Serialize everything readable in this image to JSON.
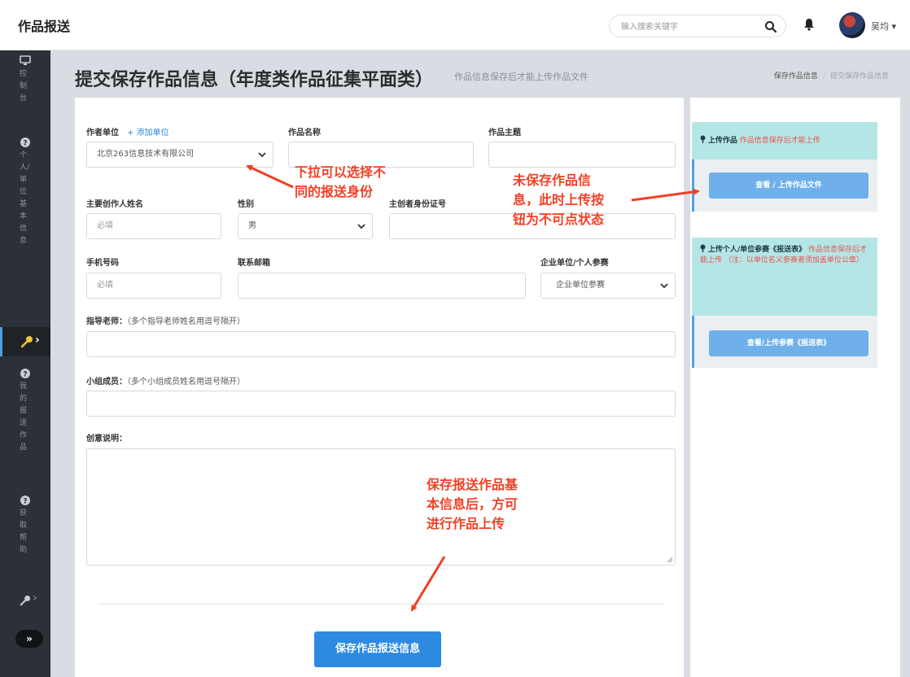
{
  "topbar": {
    "brand": "作品报送",
    "search_placeholder": "输入搜索关键字",
    "username": "吴均 ▾"
  },
  "sidebar": {
    "groups": [
      {
        "icon": "monitor-icon",
        "label": "控制台"
      },
      {
        "icon": "help-circle-icon",
        "label": "个人/单位基本信息"
      },
      {
        "icon": "help-circle-icon",
        "label": "我的报送作品"
      },
      {
        "icon": "help-circle-icon",
        "label": "获取帮助"
      }
    ],
    "active_arrow": "›",
    "key_arrow": "›",
    "collapse_label": "»"
  },
  "header": {
    "title": "提交保存作品信息（年度类作品征集平面类）",
    "subtitle": "作品信息保存后才能上传作品文件",
    "breadcrumb": [
      "保存作品信息",
      "提交保存作品信息"
    ]
  },
  "form": {
    "author_unit_label": "作者单位",
    "add_unit_link": "+ 添加单位",
    "author_unit_value": "北京263信息技术有限公司",
    "work_name_label": "作品名称",
    "work_theme_label": "作品主题",
    "creator_name_label": "主要创作人姓名",
    "creator_name_placeholder": "必填",
    "gender_label": "性别",
    "gender_value": "男",
    "id_label": "主创者身份证号",
    "phone_label": "手机号码",
    "phone_placeholder": "必填",
    "email_label": "联系邮箱",
    "entry_type_label": "企业单位/个人参赛",
    "entry_type_value": "企业单位参赛",
    "teacher_label": "指导老师：",
    "teacher_hint": "（多个指导老师姓名用逗号隔开）",
    "members_label": "小组成员：",
    "members_hint": "（多个小组成员姓名用逗号隔开）",
    "creative_label": "创意说明：",
    "save_button": "保存作品报送信息"
  },
  "right": {
    "upload_work_title": "上传作品",
    "upload_work_note": "作品信息保存后才能上传",
    "upload_work_button": "查看 / 上传作品文件",
    "upload_form_title": "上传个人/单位参赛《报送表》",
    "upload_form_note": "作品信息保存后才能上传",
    "upload_form_note2": "（注：以单位名义参赛者须加盖单位公章）",
    "upload_form_button": "查看/上传参赛《报送表》"
  },
  "annotations": {
    "dropdown_tip": [
      "下拉可以选择不",
      "同的报送身份"
    ],
    "upload_tip": [
      "未保存作品信",
      "息，此时上传按",
      "钮为不可点状态"
    ],
    "save_tip": [
      "保存报送作品基",
      "本信息后，方可",
      "进行作品上传"
    ]
  },
  "colors": {
    "primary": "#2d8ae0",
    "annotation": "#f23f24",
    "info_box": "#b5e6e6",
    "sidebar": "#2c3137"
  }
}
